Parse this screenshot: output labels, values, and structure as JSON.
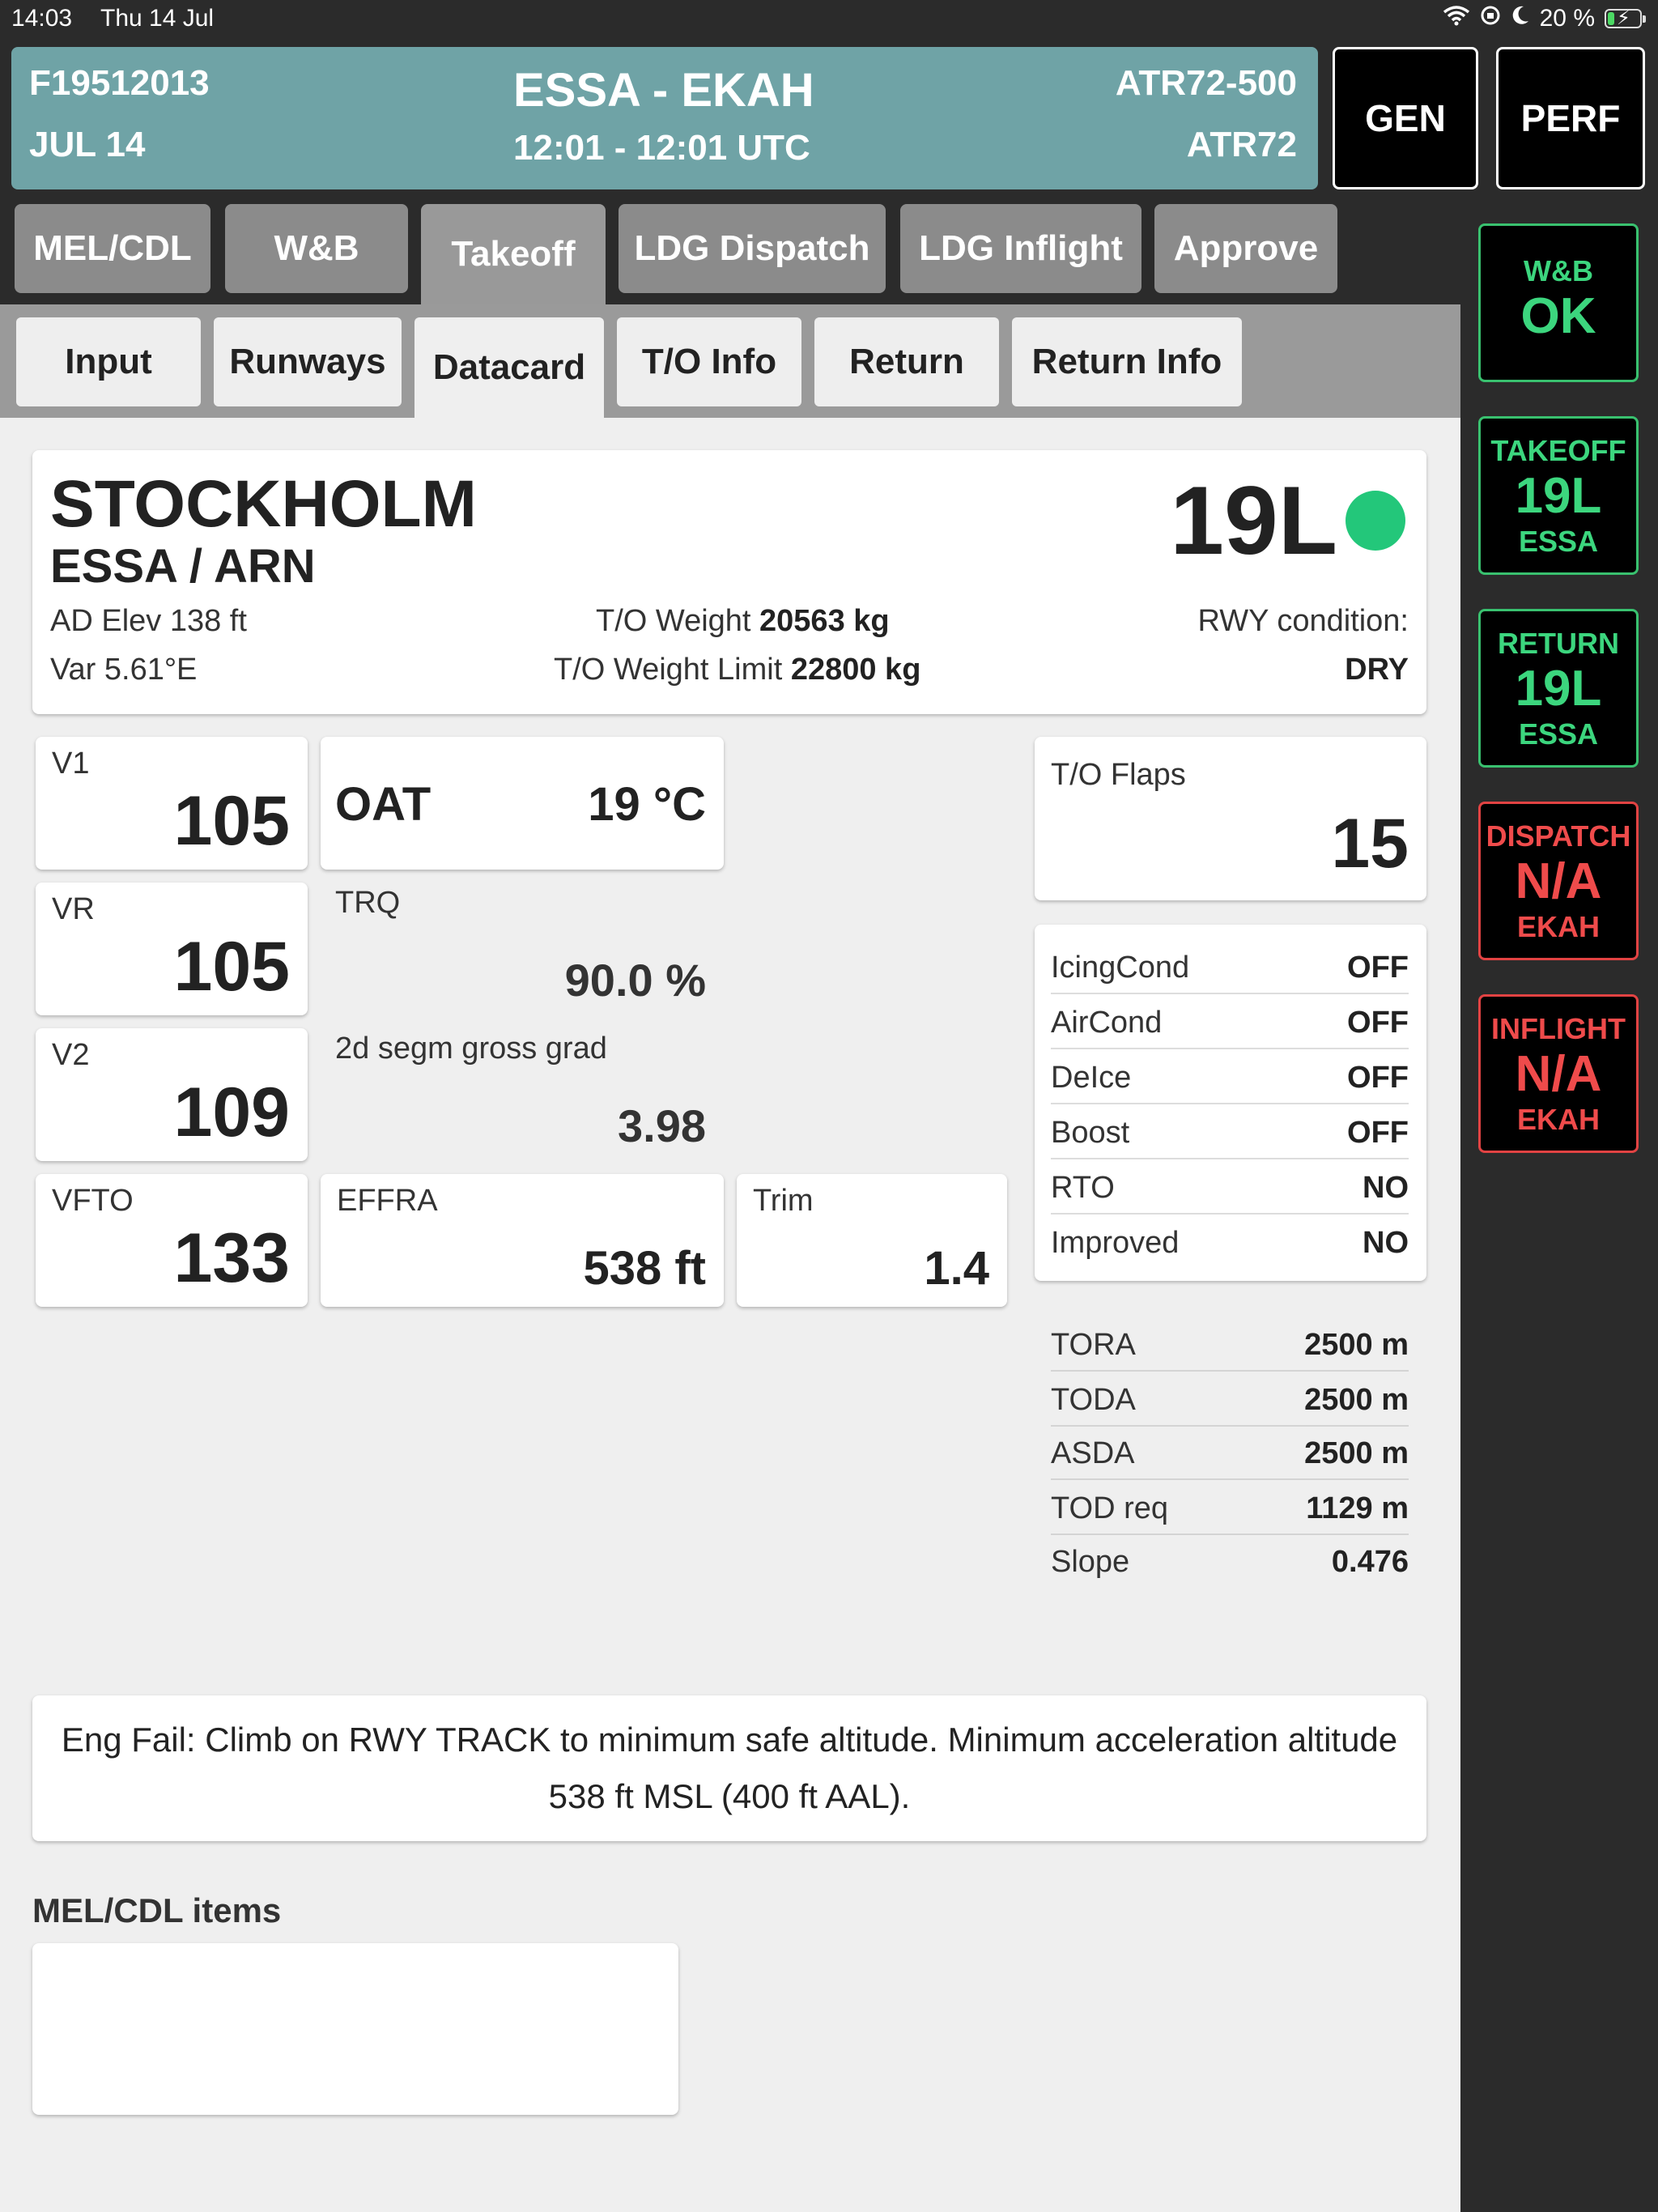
{
  "status_bar": {
    "time": "14:03",
    "date": "Thu 14 Jul",
    "battery": "20 %",
    "battery_level": 0.2
  },
  "flight": {
    "id": "F19512013",
    "date": "JUL 14",
    "route": "ESSA - EKAH",
    "time": "12:01 - 12:01 UTC",
    "aircraft_type": "ATR72-500",
    "aircraft_model": "ATR72",
    "header_color": "#6fa3a6"
  },
  "top_buttons": {
    "gen": "GEN",
    "perf": "PERF"
  },
  "main_tabs": [
    {
      "label": "MEL/CDL"
    },
    {
      "label": "W&B"
    },
    {
      "label": "Takeoff",
      "active": true
    },
    {
      "label": "LDG Dispatch"
    },
    {
      "label": "LDG Inflight"
    },
    {
      "label": "Approve"
    }
  ],
  "sub_tabs": [
    {
      "label": "Input"
    },
    {
      "label": "Runways"
    },
    {
      "label": "Datacard",
      "active": true
    },
    {
      "label": "T/O Info"
    },
    {
      "label": "Return"
    },
    {
      "label": "Return Info"
    }
  ],
  "airport": {
    "name": "STOCKHOLM",
    "codes": "ESSA / ARN",
    "elev": "AD Elev 138 ft",
    "var": "Var 5.61°E",
    "tow_label": "T/O Weight",
    "tow_value": "20563 kg",
    "towl_label": "T/O Weight Limit",
    "towl_value": "22800 kg",
    "runway": "19L",
    "runway_status_color": "#23c77a",
    "cond_label": "RWY condition:",
    "cond_value": "DRY"
  },
  "speeds": {
    "v1": {
      "label": "V1",
      "value": "105"
    },
    "vr": {
      "label": "VR",
      "value": "105"
    },
    "v2": {
      "label": "V2",
      "value": "109"
    },
    "vfto": {
      "label": "VFTO",
      "value": "133"
    }
  },
  "oat": {
    "label": "OAT",
    "value": "19 °C"
  },
  "trq": {
    "label": "TRQ",
    "value": "90.0 %"
  },
  "grad": {
    "label": "2d segm gross grad",
    "value": "3.98"
  },
  "effra": {
    "label": "EFFRA",
    "value": "538 ft"
  },
  "trim": {
    "label": "Trim",
    "value": "1.4"
  },
  "flaps": {
    "label": "T/O Flaps",
    "value": "15"
  },
  "toggles": [
    {
      "key": "IcingCond",
      "value": "OFF"
    },
    {
      "key": "AirCond",
      "value": "OFF"
    },
    {
      "key": "DeIce",
      "value": "OFF"
    },
    {
      "key": "Boost",
      "value": "OFF"
    },
    {
      "key": "RTO",
      "value": "NO"
    },
    {
      "key": "Improved",
      "value": "NO"
    }
  ],
  "distances": [
    {
      "key": "TORA",
      "value": "2500 m"
    },
    {
      "key": "TODA",
      "value": "2500 m"
    },
    {
      "key": "ASDA",
      "value": "2500 m"
    },
    {
      "key": "TOD req",
      "value": "1129 m"
    },
    {
      "key": "Slope",
      "value": "0.476"
    }
  ],
  "note": "Eng Fail: Climb on RWY TRACK to minimum safe altitude. Minimum acceleration altitude 538 ft MSL (400 ft AAL).",
  "mel_title": "MEL/CDL items",
  "sidebar": [
    {
      "label": "W&B",
      "value": "OK",
      "sub": "",
      "status": "ok",
      "color": "#3cd67e"
    },
    {
      "label": "TAKEOFF",
      "value": "19L",
      "sub": "ESSA",
      "status": "ok",
      "color": "#3cd67e"
    },
    {
      "label": "RETURN",
      "value": "19L",
      "sub": "ESSA",
      "status": "ok",
      "color": "#3cd67e"
    },
    {
      "label": "DISPATCH",
      "value": "N/A",
      "sub": "EKAH",
      "status": "error",
      "color": "#ef4b4b"
    },
    {
      "label": "INFLIGHT",
      "value": "N/A",
      "sub": "EKAH",
      "status": "error",
      "color": "#ef4b4b"
    }
  ]
}
